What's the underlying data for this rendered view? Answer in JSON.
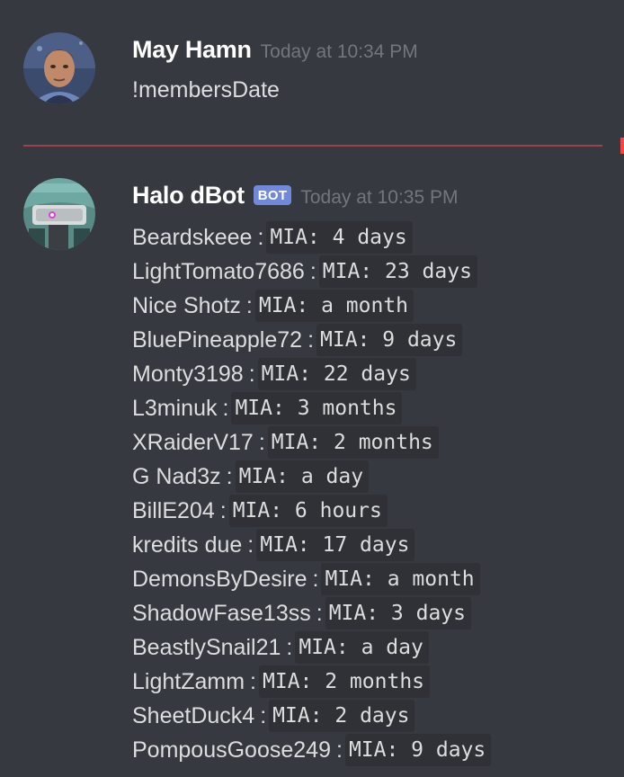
{
  "messages": [
    {
      "username": "May Hamn",
      "timestamp": "Today at 10:34 PM",
      "text": "!membersDate"
    },
    {
      "username": "Halo dBot",
      "bot_tag": "BOT",
      "timestamp": "Today at 10:35 PM"
    }
  ],
  "separator": ":",
  "bot_rows": [
    {
      "name": "Beardskeee",
      "status": "MIA: 4 days"
    },
    {
      "name": "LightTomato7686",
      "status": "MIA: 23 days"
    },
    {
      "name": "Nice Shotz",
      "status": "MIA: a month"
    },
    {
      "name": "BluePineapple72",
      "status": "MIA: 9 days"
    },
    {
      "name": "Monty3198",
      "status": "MIA: 22 days"
    },
    {
      "name": "L3minuk",
      "status": "MIA: 3 months"
    },
    {
      "name": "XRaiderV17",
      "status": "MIA: 2 months"
    },
    {
      "name": "G Nad3z",
      "status": "MIA: a day"
    },
    {
      "name": "BillE204",
      "status": "MIA: 6 hours"
    },
    {
      "name": "kredits due",
      "status": "MIA: 17 days"
    },
    {
      "name": "DemonsByDesire",
      "status": "MIA: a month"
    },
    {
      "name": "ShadowFase13ss",
      "status": "MIA: 3 days"
    },
    {
      "name": "BeastlySnail21",
      "status": "MIA: a day"
    },
    {
      "name": "LightZamm",
      "status": "MIA: 2 months"
    },
    {
      "name": "SheetDuck4",
      "status": "MIA: 2 days"
    },
    {
      "name": "PompousGoose249",
      "status": "MIA: 9 days"
    }
  ],
  "colors": {
    "background": "#36393f",
    "code_background": "#2f3136",
    "username": "#ffffff",
    "timestamp": "#72767d",
    "text": "#dcddde",
    "bot_tag": "#7289da",
    "new_messages_divider": "#f04747"
  },
  "icons": {
    "user_avatar": "portrait-avatar-icon",
    "bot_avatar": "halo-helmet-avatar-icon"
  }
}
